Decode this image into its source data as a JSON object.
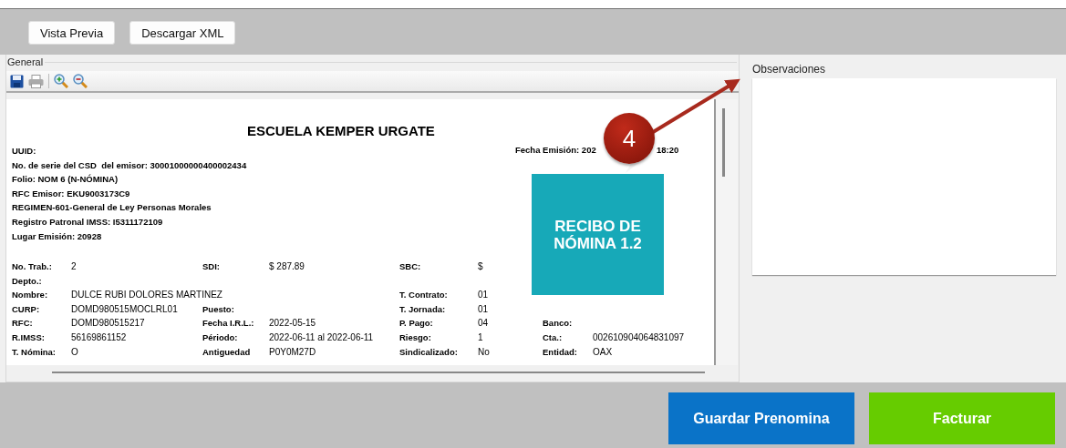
{
  "toolbar": {
    "buttons": [
      "Vista Previa",
      "Descargar XML"
    ]
  },
  "group": {
    "title": "General"
  },
  "document": {
    "title": "ESCUELA KEMPER URGATE",
    "header_lines": [
      "UUID:",
      "No. de serie del CSD  del emisor: 30001000000400002434",
      "Folio: NOM 6 (N-NÓMINA)",
      "RFC Emisor: EKU9003173C9",
      "REGIMEN-601-General de Ley Personas Morales",
      "Registro Patronal IMSS: I5311172109",
      "Lugar Emisión: 20928"
    ],
    "fecha_emision": [
      "Fecha Emisión: 202",
      "18:20"
    ],
    "stamp": "RECIBO DE NÓMINA 1.2",
    "rows": [
      [
        {
          "label": "No. Trab.:",
          "value": "2"
        },
        {
          "label": "SDI:",
          "value": "$ 287.89"
        },
        {
          "label": "SBC:",
          "value": "$"
        },
        null
      ],
      [
        {
          "label": "Depto.:"
        },
        null,
        null,
        null
      ],
      [
        {
          "label": "Nombre:",
          "value": "DULCE RUBI DOLORES MARTINEZ"
        },
        null,
        {
          "label": "T. Contrato:",
          "value": "01"
        },
        null
      ],
      [
        {
          "label": "CURP:",
          "value": "DOMD980515MOCLRL01"
        },
        {
          "label": "Puesto:"
        },
        {
          "label": "T. Jornada:",
          "value": "01"
        },
        null
      ],
      [
        {
          "label": "RFC:",
          "value": "DOMD980515217"
        },
        {
          "label": "Fecha I.R.L.:",
          "value": "2022-05-15"
        },
        {
          "label": "P. Pago:",
          "value": "04"
        },
        {
          "label": "Banco:"
        }
      ],
      [
        {
          "label": "R.IMSS:",
          "value": "56169861152"
        },
        {
          "label": "Périodo:",
          "value": "2022-06-11 al 2022-06-11"
        },
        {
          "label": "Riesgo:",
          "value": "1"
        },
        {
          "label": "Cta.:",
          "value": "002610904064831097"
        }
      ],
      [
        {
          "label": "T. Nómina:",
          "value": "O"
        },
        {
          "label": "Antiguedad",
          "value": "P0Y0M27D"
        },
        {
          "label": "Sindicalizado:",
          "value": "No"
        },
        {
          "label": "Entidad:",
          "value": "OAX"
        }
      ]
    ]
  },
  "observaciones": {
    "label": "Observaciones"
  },
  "annotation": {
    "number": "4"
  },
  "actions": [
    {
      "label": "Guardar Prenomina",
      "color": "#0a73c8"
    },
    {
      "label": "Facturar",
      "color": "#66cc00"
    }
  ]
}
